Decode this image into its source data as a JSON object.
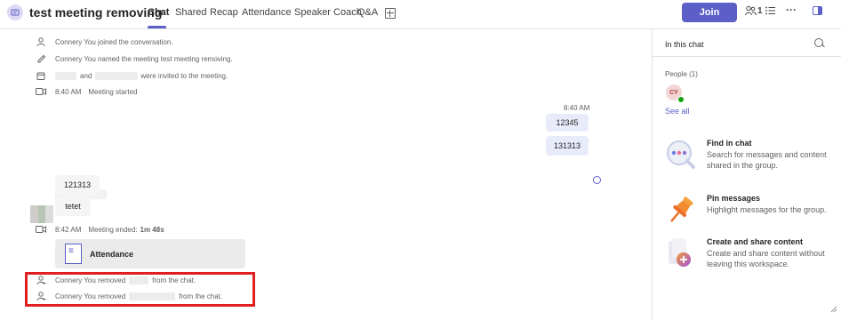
{
  "header": {
    "title": "test meeting removing",
    "tabs": [
      "Chat",
      "Shared",
      "Recap",
      "Attendance",
      "Speaker Coach",
      "Q&A"
    ],
    "join_label": "Join",
    "participants_count": "1"
  },
  "messages": {
    "sys1": "Connery You joined the conversation.",
    "sys2": "Connery You named the meeting test meeting removing.",
    "sys3_and": "and",
    "sys3_rest": "were invited to the meeting.",
    "meeting_started_time": "8:40 AM",
    "meeting_started_text": "Meeting started",
    "my_time": "8:40 AM",
    "my_msgs": [
      "12345",
      "131313"
    ],
    "other_msgs": [
      "121313",
      "tetet"
    ],
    "meeting_ended_time": "8:42 AM",
    "meeting_ended_text": "Meeting ended:",
    "meeting_duration": "1m 48s",
    "attendance_label": "Attendance",
    "removed1_a": "Connery You removed",
    "removed1_b": "from the chat.",
    "removed2_a": "Connery You removed",
    "removed2_b": "from the chat."
  },
  "right_panel": {
    "title": "In this chat",
    "people_label": "People (1)",
    "avatar_initials": "CY",
    "see_all": "See all",
    "features": [
      {
        "title": "Find in chat",
        "desc": "Search for messages and content shared in the group."
      },
      {
        "title": "Pin messages",
        "desc": "Highlight messages for the group."
      },
      {
        "title": "Create and share content",
        "desc": "Create and share content without leaving this workspace."
      }
    ]
  },
  "colors": {
    "accent": "#5b5fc7",
    "highlight": "#e02020"
  }
}
